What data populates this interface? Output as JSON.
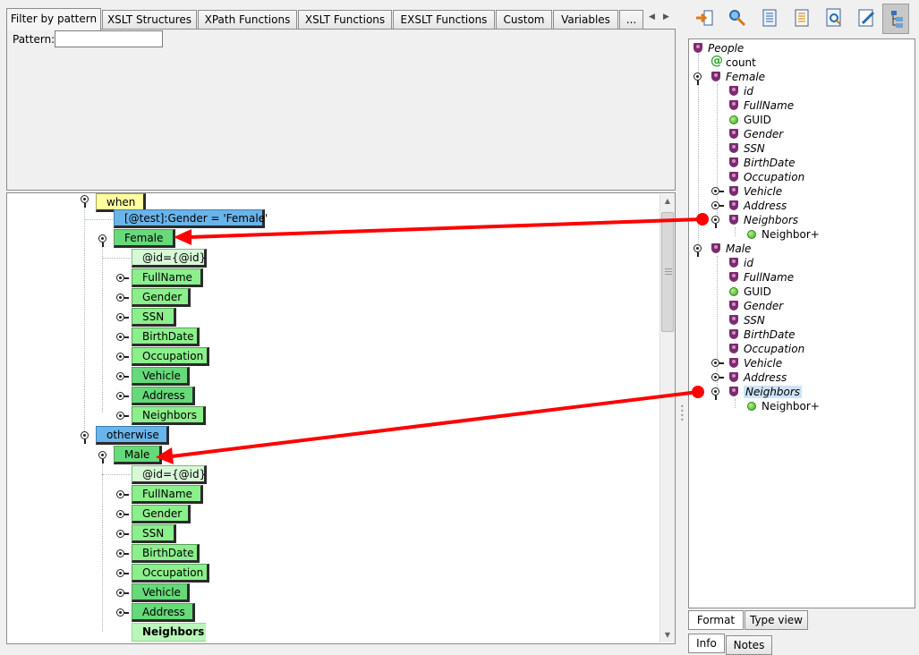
{
  "filter_tabs": [
    {
      "label": "Filter by pattern"
    },
    {
      "label": "XSLT Structures"
    },
    {
      "label": "XPath Functions"
    },
    {
      "label": "XSLT Functions"
    },
    {
      "label": "EXSLT Functions"
    },
    {
      "label": "Custom"
    },
    {
      "label": "Variables"
    },
    {
      "label": "..."
    }
  ],
  "filter": {
    "pattern_label": "Pattern:",
    "pattern_value": ""
  },
  "template_tree": {
    "when": "when",
    "test": "[@test]:Gender = 'Female'",
    "female": {
      "label": "Female",
      "children": [
        "@id={@id}",
        "FullName",
        "Gender",
        "SSN",
        "BirthDate",
        "Occupation",
        "Vehicle",
        "Address",
        "Neighbors"
      ]
    },
    "otherwise": "otherwise",
    "male": {
      "label": "Male",
      "children": [
        "@id={@id}",
        "FullName",
        "Gender",
        "SSN",
        "BirthDate",
        "Occupation",
        "Vehicle",
        "Address",
        "Neighbors"
      ]
    }
  },
  "toolbar": [
    "move-in-icon",
    "pick-icon",
    "list-icon",
    "list-alt-icon",
    "find-icon",
    "edit-icon",
    "tree-view-icon"
  ],
  "schema_tree": {
    "root": "People",
    "count": "count",
    "female": "Female",
    "female_children": [
      "id",
      "FullName",
      "GUID",
      "Gender",
      "SSN",
      "BirthDate",
      "Occupation",
      "Vehicle",
      "Address",
      "Neighbors"
    ],
    "female_neighbor": "Neighbor+",
    "male": "Male",
    "male_children": [
      "id",
      "FullName",
      "GUID",
      "Gender",
      "SSN",
      "BirthDate",
      "Occupation",
      "Vehicle",
      "Address",
      "Neighbors"
    ],
    "male_neighbor": "Neighbor+"
  },
  "schema_tabs": [
    "Format",
    "Type view"
  ],
  "info_tabs": [
    "Info",
    "Notes"
  ],
  "colors": {
    "arrow": "#ff0000",
    "node_green": "#66d97a",
    "node_blue": "#69b4ea",
    "node_yellow": "#ffffa0"
  }
}
